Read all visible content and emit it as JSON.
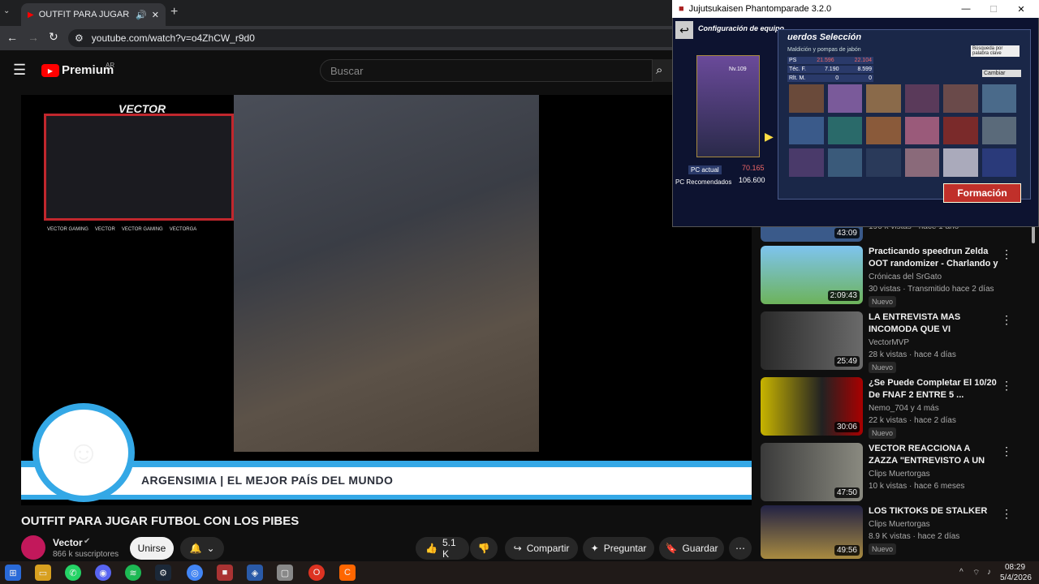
{
  "browser": {
    "tab_title": "OUTFIT PARA JUGAR FUTBO",
    "url": "youtube.com/watch?v=o4ZhCW_r9d0",
    "new_tab": "+"
  },
  "youtube": {
    "logo": "Premium",
    "region": "AR",
    "search_placeholder": "Buscar"
  },
  "video": {
    "overlay_name": "VECTOR",
    "ticker": "ARGENSIMIA | EL MEJOR PAÍS DEL MUNDO",
    "socials": [
      "VECTOR GAMING",
      "VECTOR",
      "VECTOR GAMING",
      "VECTORGA"
    ],
    "title": "OUTFIT PARA JUGAR FUTBOL CON LOS PIBES"
  },
  "channel": {
    "name": "Vector",
    "subs": "866 k suscriptores",
    "join": "Unirse"
  },
  "actions": {
    "likes": "5.1 K",
    "share": "Compartir",
    "ask": "Preguntar",
    "save": "Guardar"
  },
  "recs": [
    {
      "dur": "43:09",
      "meta": "196 k vistas · hace 1 año"
    },
    {
      "title": "Practicando speedrun Zelda OOT randomizer - Charlando y ...",
      "channel": "Crónicas del SrGato",
      "meta": "30 vistas · Transmitido hace 2 días",
      "badge": "Nuevo",
      "dur": "2:09:43"
    },
    {
      "title": "LA ENTREVISTA MAS INCOMODA QUE VI",
      "channel": "VectorMVP",
      "meta": "28 k vistas · hace 4 días",
      "badge": "Nuevo",
      "dur": "25:49"
    },
    {
      "title": "¿Se Puede Completar El 10/20 De FNAF 2 ENTRE 5 ...",
      "channel": "Nemo_704 y 4 más",
      "meta": "22 k vistas · hace 2 días",
      "badge": "Nuevo",
      "dur": "30:06"
    },
    {
      "title": "VECTOR REACCIONA A ZAZZA \"ENTREVISTO A UN GATILLER...",
      "channel": "Clips Muertorgas",
      "meta": "10 k vistas · hace 6 meses",
      "dur": "47:50"
    },
    {
      "title": "LOS TIKTOKS DE STALKER",
      "channel": "Clips Muertorgas",
      "meta": "8.9 K vistas · hace 2 días",
      "badge": "Nuevo",
      "dur": "49:56"
    }
  ],
  "game": {
    "window_title": "Jujutsukaisen Phantomparade 3.2.0",
    "header": "Configuración de equipo",
    "section": "uerdos Selección",
    "sub": "Maldición y pompas de jabón",
    "search": "Búsqueda por palabra clave",
    "cambiar": "Cambiar",
    "pc_actual_label": "PC actual",
    "pc_actual": "70.165",
    "pc_rec_label": "PC Recomendados",
    "pc_rec": "106.600",
    "formacion": "Formación",
    "nivel": "Nv.109",
    "stats": [
      [
        "PS",
        "21.596",
        "22.104"
      ],
      [
        "Téc. F.",
        "7.190",
        "8.599"
      ],
      [
        "Rlt. M.",
        "0",
        "0"
      ]
    ]
  },
  "taskbar": {
    "time": "08:29",
    "date": "5/4/2026"
  },
  "colors": {
    "accent": "#ff0000",
    "ticker_blue": "#34a8e6"
  }
}
